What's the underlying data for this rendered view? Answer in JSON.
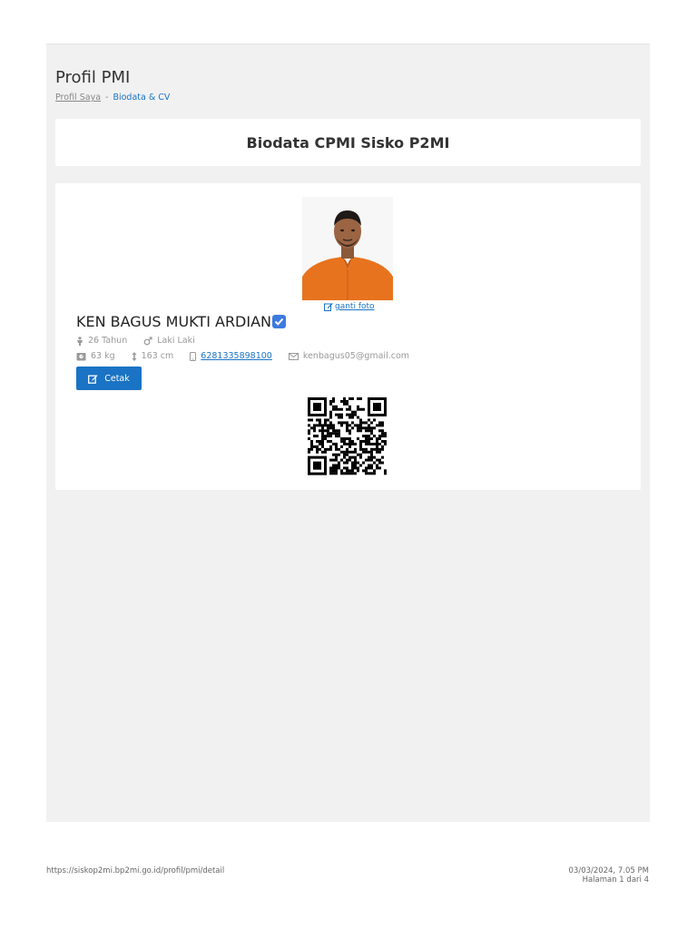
{
  "header": {
    "title": "Profil PMI",
    "breadcrumb": [
      {
        "label": "Profil Saya"
      },
      {
        "label": "Biodata & CV"
      }
    ],
    "separator": "-"
  },
  "card_title": "Biodata CPMI Sisko P2MI",
  "profile": {
    "change_photo_label": "ganti foto",
    "name": "KEN BAGUS MUKTI ARDIAN",
    "age": "26 Tahun",
    "gender": "Laki Laki",
    "weight": "63 kg",
    "height": "163 cm",
    "phone": "6281335898100",
    "email": "kenbagus05@gmail.com",
    "print_label": "Cetak"
  },
  "footer": {
    "url": "https://siskop2mi.bp2mi.go.id/profil/pmi/detail",
    "datetime": "03/03/2024, 7.05 PM",
    "page": "Halaman 1 dari 4"
  },
  "colors": {
    "accent": "#1a73c4",
    "verified": "#3d7be0",
    "shirt": "#e8731f"
  }
}
